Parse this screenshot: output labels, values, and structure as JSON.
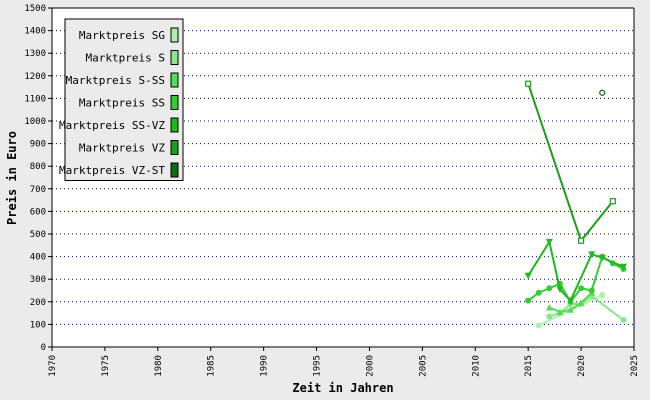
{
  "chart_data": {
    "type": "line",
    "title": "",
    "xlabel": "Zeit in Jahren",
    "ylabel": "Preis in Euro",
    "xlim": [
      1970,
      2025
    ],
    "ylim": [
      0,
      1500
    ],
    "x_ticks": [
      "1970",
      "1975",
      "1980",
      "1985",
      "1990",
      "1995",
      "2000",
      "2005",
      "2010",
      "2015",
      "2020",
      "2025"
    ],
    "y_ticks": [
      "0",
      "100",
      "200",
      "300",
      "400",
      "500",
      "600",
      "700",
      "800",
      "900",
      "1000",
      "1100",
      "1200",
      "1300",
      "1400",
      "1500"
    ],
    "grid": "horizontal dotted",
    "legend_position": "top-left",
    "series": [
      {
        "name": "Marktpreis SG",
        "color": "#aaf2aa",
        "marker": "circle",
        "points": [
          [
            2016,
            95
          ],
          [
            2022,
            230
          ]
        ]
      },
      {
        "name": "Marktpreis S",
        "color": "#88e888",
        "marker": "circle",
        "points": [
          [
            2017,
            135
          ],
          [
            2018,
            150
          ],
          [
            2019,
            190
          ],
          [
            2020,
            190
          ],
          [
            2021,
            225
          ],
          [
            2024,
            120
          ]
        ]
      },
      {
        "name": "Marktpreis S-SS",
        "color": "#55dd55",
        "marker": "triangle",
        "points": [
          [
            2017,
            175
          ],
          [
            2018,
            155
          ],
          [
            2019,
            165
          ],
          [
            2020,
            195
          ],
          [
            2021,
            240
          ]
        ]
      },
      {
        "name": "Marktpreis SS",
        "color": "#33cc33",
        "marker": "circle",
        "points": [
          [
            2015,
            205
          ],
          [
            2016,
            240
          ],
          [
            2017,
            260
          ],
          [
            2018,
            280
          ],
          [
            2019,
            200
          ],
          [
            2020,
            260
          ],
          [
            2021,
            250
          ],
          [
            2022,
            400
          ],
          [
            2023,
            370
          ],
          [
            2024,
            345
          ]
        ]
      },
      {
        "name": "Marktpreis SS-VZ",
        "color": "#1fb81f",
        "marker": "triangle-down",
        "points": [
          [
            2015,
            315
          ],
          [
            2017,
            465
          ],
          [
            2018,
            255
          ],
          [
            2019,
            205
          ],
          [
            2021,
            410
          ],
          [
            2022,
            395
          ],
          [
            2024,
            355
          ]
        ]
      },
      {
        "name": "Marktpreis VZ",
        "color": "#19a019",
        "marker": "square",
        "points": [
          [
            2015,
            1165
          ],
          [
            2020,
            470
          ],
          [
            2023,
            645
          ]
        ]
      },
      {
        "name": "Marktpreis VZ-ST",
        "color": "#0c6e0c",
        "marker": "circle-open",
        "points": [
          [
            2022,
            1125
          ]
        ]
      }
    ]
  }
}
